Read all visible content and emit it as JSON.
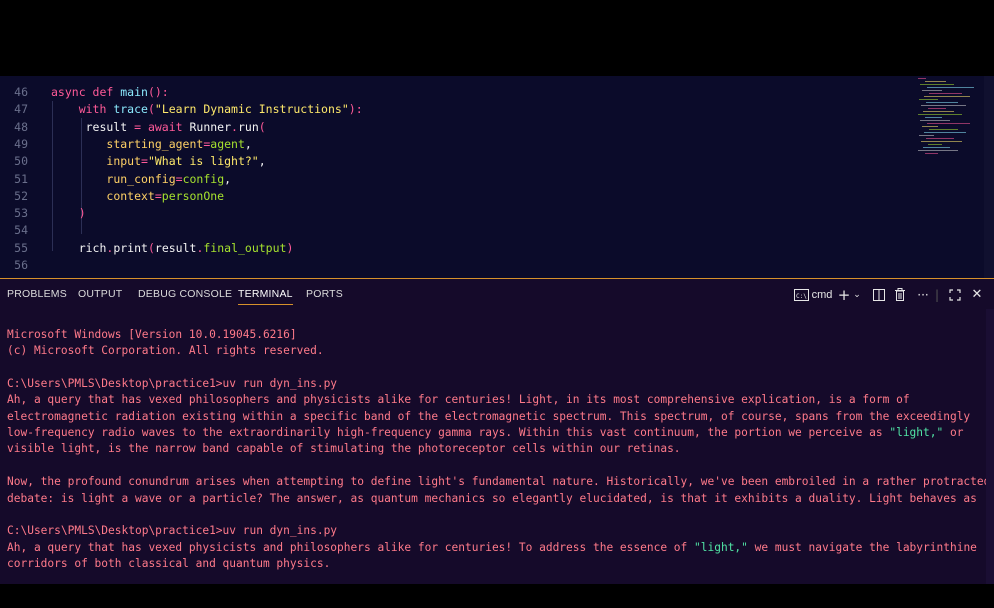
{
  "editor": {
    "lines": [
      {
        "num": "46",
        "tokens": [
          [
            "kw",
            "async "
          ],
          [
            "kw",
            "def "
          ],
          [
            "fn",
            "main"
          ],
          [
            "par",
            "():"
          ]
        ]
      },
      {
        "num": "47",
        "tokens": [
          [
            "pl",
            "    "
          ],
          [
            "kw",
            "with "
          ],
          [
            "fn",
            "trace"
          ],
          [
            "par",
            "("
          ],
          [
            "str",
            "\"Learn Dynamic Instructions\""
          ],
          [
            "par",
            "):"
          ]
        ]
      },
      {
        "num": "48",
        "tokens": [
          [
            "pl",
            "     result "
          ],
          [
            "kw",
            "= await "
          ],
          [
            "pl",
            "Runner"
          ],
          [
            "par",
            "."
          ],
          [
            "pl",
            "run"
          ],
          [
            "par",
            "("
          ]
        ]
      },
      {
        "num": "49",
        "tokens": [
          [
            "pl",
            "        "
          ],
          [
            "arg",
            "starting_agent"
          ],
          [
            "kw",
            "="
          ],
          [
            "val",
            "agent"
          ],
          [
            "pl",
            ","
          ]
        ]
      },
      {
        "num": "50",
        "tokens": [
          [
            "pl",
            "        "
          ],
          [
            "arg",
            "input"
          ],
          [
            "kw",
            "="
          ],
          [
            "str",
            "\"What is light?\""
          ],
          [
            "pl",
            ","
          ]
        ]
      },
      {
        "num": "51",
        "tokens": [
          [
            "pl",
            "        "
          ],
          [
            "arg",
            "run_config"
          ],
          [
            "kw",
            "="
          ],
          [
            "val",
            "config"
          ],
          [
            "pl",
            ","
          ]
        ]
      },
      {
        "num": "52",
        "tokens": [
          [
            "pl",
            "        "
          ],
          [
            "arg",
            "context"
          ],
          [
            "kw",
            "="
          ],
          [
            "val",
            "personOne"
          ]
        ]
      },
      {
        "num": "53",
        "tokens": [
          [
            "pl",
            "    "
          ],
          [
            "par",
            ")"
          ]
        ]
      },
      {
        "num": "54",
        "tokens": []
      },
      {
        "num": "55",
        "tokens": [
          [
            "pl",
            "    rich"
          ],
          [
            "par",
            "."
          ],
          [
            "pl",
            "print"
          ],
          [
            "par",
            "("
          ],
          [
            "pl",
            "result"
          ],
          [
            "par",
            "."
          ],
          [
            "attr",
            "final_output"
          ],
          [
            "par",
            ")"
          ]
        ]
      },
      {
        "num": "56",
        "tokens": []
      }
    ]
  },
  "panel": {
    "tabs": [
      "PROBLEMS",
      "OUTPUT",
      "DEBUG CONSOLE",
      "TERMINAL",
      "PORTS"
    ],
    "active_tab": "TERMINAL",
    "shell_label": "cmd",
    "icons": {
      "shell": "terminal-icon",
      "add": "plus-icon",
      "dropdown": "chevron-down-icon",
      "split": "split-icon",
      "trash": "trash-icon",
      "more": "more-icon",
      "maximize": "maximize-icon",
      "close": "close-icon"
    }
  },
  "terminal": {
    "lines": [
      [
        [
          "t",
          "Microsoft Windows [Version 10.0.19045.6216]"
        ]
      ],
      [
        [
          "t",
          "(c) Microsoft Corporation. All rights reserved."
        ]
      ],
      [],
      [
        [
          "t",
          "C:\\Users\\PMLS\\Desktop\\practice1>uv run dyn_ins.py"
        ]
      ],
      [
        [
          "t",
          "Ah, a query that has vexed philosophers and physicists alike for centuries! Light, in its most comprehensive explication, is a form of"
        ]
      ],
      [
        [
          "t",
          "electromagnetic radiation existing within a specific band of the electromagnetic spectrum. This spectrum, of course, spans from the exceedingly"
        ]
      ],
      [
        [
          "t",
          "low-frequency radio waves to the extraordinarily high-frequency gamma rays. Within this vast continuum, the portion we perceive as "
        ],
        [
          "h",
          "\"light,\""
        ],
        [
          "t",
          " or"
        ]
      ],
      [
        [
          "t",
          "visible light, is the narrow band capable of stimulating the photoreceptor cells within our retinas."
        ]
      ],
      [],
      [
        [
          "t",
          "Now, the profound conundrum arises when attempting to define light's fundamental nature. Historically, we've been embroiled in a rather protracted"
        ]
      ],
      [
        [
          "t",
          "debate: is light a wave or a particle? The answer, as quantum mechanics so elegantly elucidated, is that it exhibits a duality. Light behaves as"
        ]
      ],
      [],
      [
        [
          "t",
          "C:\\Users\\PMLS\\Desktop\\practice1>uv run dyn_ins.py"
        ]
      ],
      [
        [
          "t",
          "Ah, a query that has vexed physicists and philosophers alike for centuries! To address the essence of "
        ],
        [
          "h",
          "\"light,\""
        ],
        [
          "t",
          " we must navigate the labyrinthine"
        ]
      ],
      [
        [
          "t",
          "corridors of both classical and quantum physics."
        ]
      ]
    ]
  },
  "colors": {
    "editor_bg": "#0b0b2a",
    "panel_bg": "#150a2a",
    "accent": "#d6912b",
    "terminal_text": "#ff7a8a",
    "terminal_highlight": "#50e3a4"
  }
}
